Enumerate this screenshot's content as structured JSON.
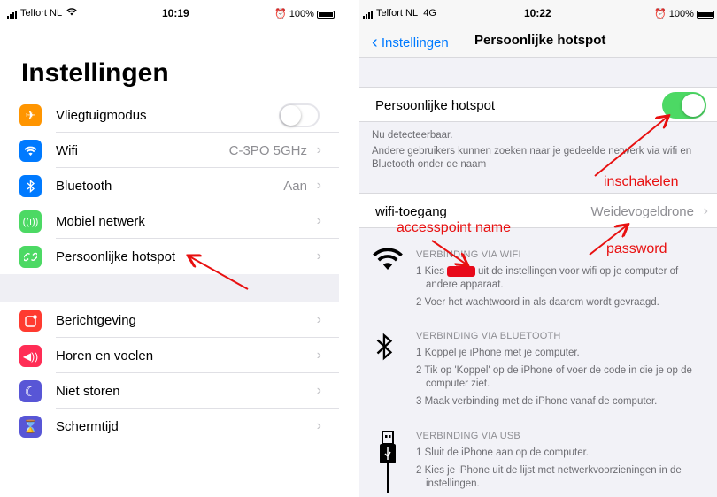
{
  "left": {
    "status": {
      "carrier": "Telfort NL",
      "time": "10:19",
      "battery": "100%"
    },
    "title": "Instellingen",
    "group1": [
      {
        "label": "Vliegtuigmodus",
        "value": "",
        "icon": "airplane-icon",
        "color": "#ff9500"
      },
      {
        "label": "Wifi",
        "value": "C-3PO 5GHz",
        "icon": "wifi-icon",
        "color": "#007aff"
      },
      {
        "label": "Bluetooth",
        "value": "Aan",
        "icon": "bluetooth-icon",
        "color": "#007aff"
      },
      {
        "label": "Mobiel netwerk",
        "value": "",
        "icon": "cellular-icon",
        "color": "#4cd964"
      },
      {
        "label": "Persoonlijke hotspot",
        "value": "",
        "icon": "hotspot-icon",
        "color": "#4cd964"
      }
    ],
    "group2": [
      {
        "label": "Berichtgeving",
        "icon": "notifications-icon",
        "color": "#ff3b30"
      },
      {
        "label": "Horen en voelen",
        "icon": "sound-icon",
        "color": "#ff2d55"
      },
      {
        "label": "Niet storen",
        "icon": "moon-icon",
        "color": "#5856d6"
      },
      {
        "label": "Schermtijd",
        "icon": "hourglass-icon",
        "color": "#5856d6"
      }
    ]
  },
  "right": {
    "status": {
      "carrier": "Telfort NL",
      "network": "4G",
      "time": "10:22",
      "battery": "100%"
    },
    "nav": {
      "back": "Instellingen",
      "title": "Persoonlijke hotspot"
    },
    "hotspot_label": "Persoonlijke hotspot",
    "hotspot_on": true,
    "footnote1": "Nu detecteerbaar.",
    "footnote2": "Andere gebruikers kunnen zoeken naar je gedeelde netwerk via wifi en Bluetooth onder de naam",
    "wifi_label": "wifi-toegang",
    "wifi_password": "Weidevogeldrone",
    "wifi_section": {
      "head": "VERBINDING VIA WIFI",
      "step1_pre": "1 Kies",
      "step1_post": "uit de instellingen voor wifi op je computer of andere apparaat.",
      "step2": "2 Voer het wachtwoord in als daarom wordt gevraagd."
    },
    "bt_section": {
      "head": "VERBINDING VIA BLUETOOTH",
      "steps": [
        "1 Koppel je iPhone met je computer.",
        "2 Tik op 'Koppel' op de iPhone of voer de code in die je op de computer ziet.",
        "3 Maak verbinding met de iPhone vanaf de computer."
      ]
    },
    "usb_section": {
      "head": "VERBINDING VIA USB",
      "steps": [
        "1 Sluit de iPhone aan op de computer.",
        "2 Kies je iPhone uit de lijst met netwerkvoorzieningen in de instellingen."
      ]
    }
  },
  "annotations": {
    "inschakelen": "inschakelen",
    "accesspoint": "accesspoint name",
    "password": "password",
    "color": "#e81010"
  }
}
